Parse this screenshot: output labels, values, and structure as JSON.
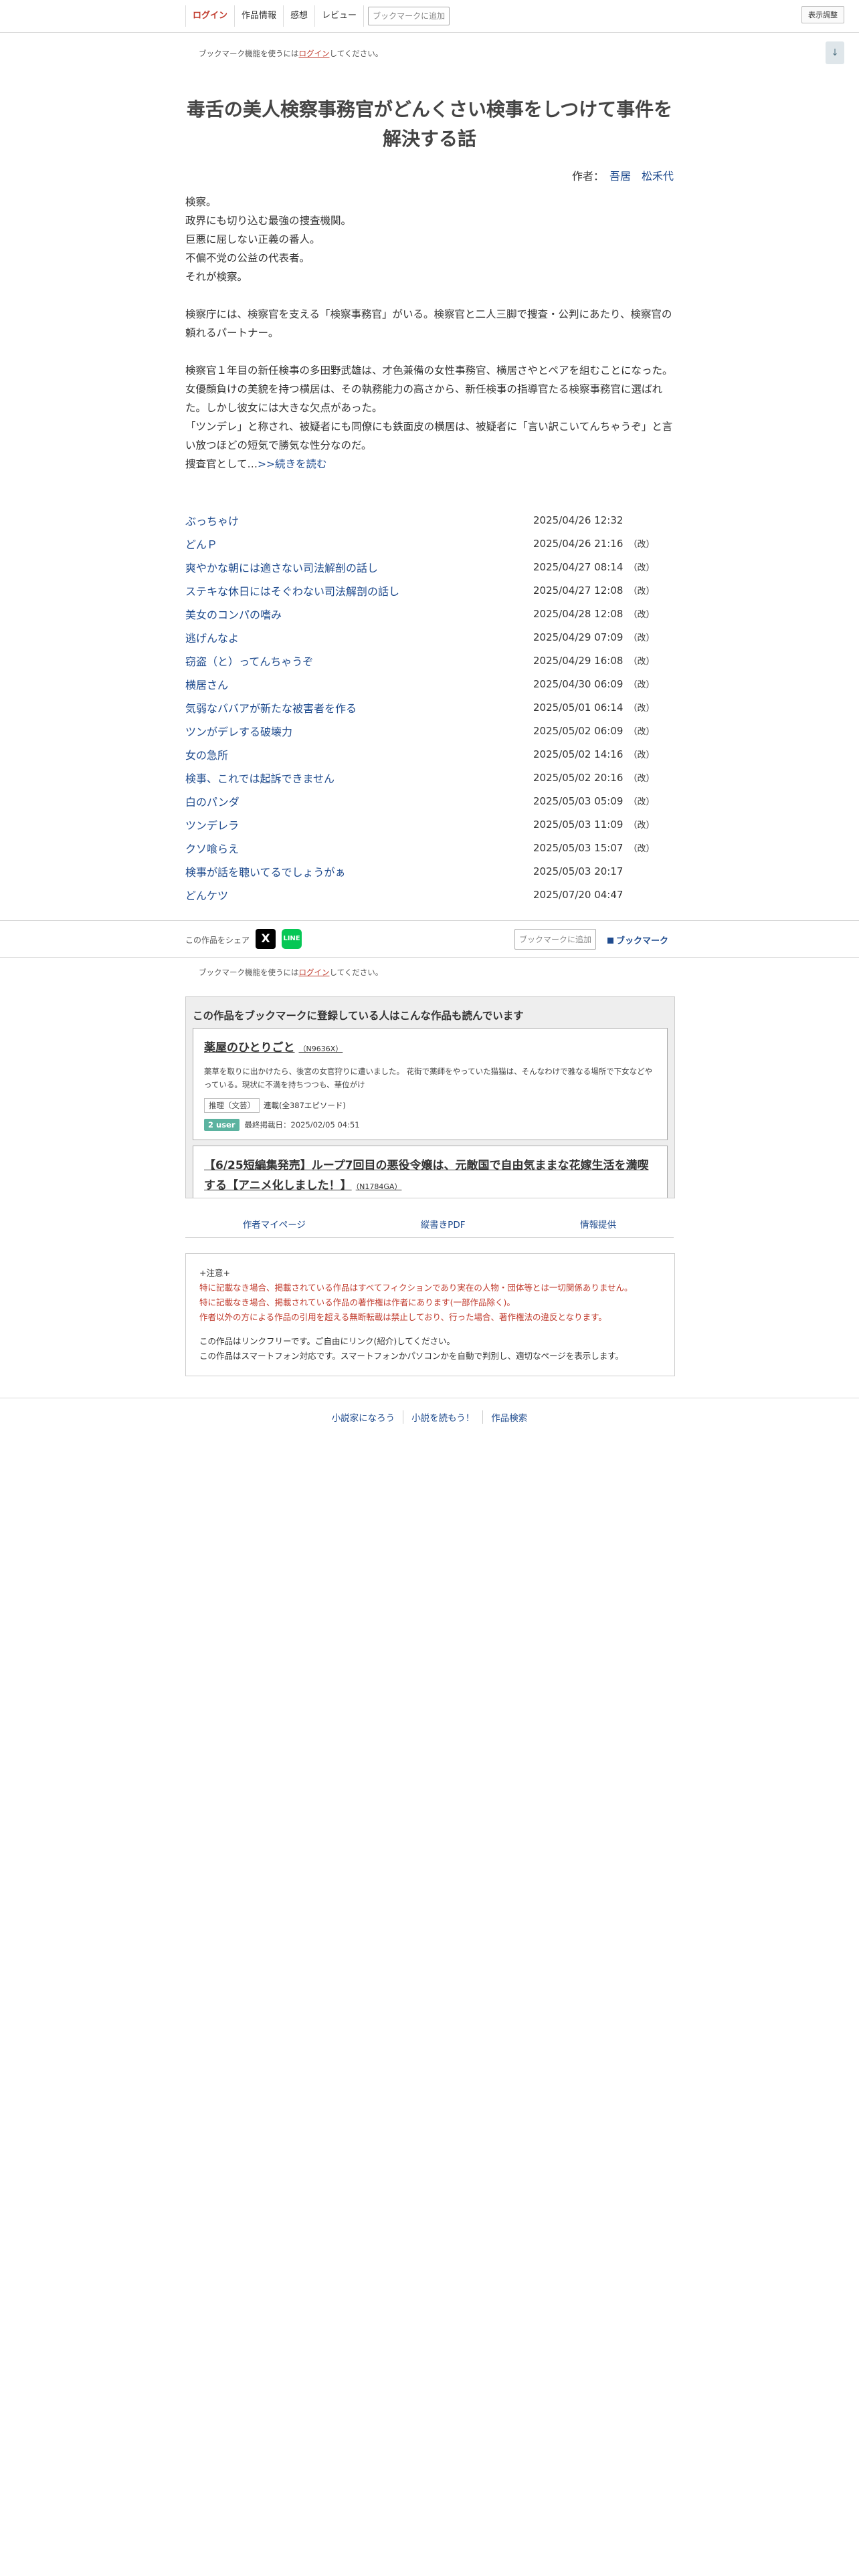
{
  "topbar": {
    "login": "ログイン",
    "info": "作品情報",
    "impression": "感想",
    "review": "レビュー",
    "bookmark_add": "ブックマークに追加",
    "display": "表示調整"
  },
  "notice": {
    "prefix": "ブックマーク機能を使うには",
    "link": "ログイン",
    "suffix": "してください。"
  },
  "scroll_top": "↓",
  "novel": {
    "title": "毒舌の美人検察事務官がどんくさい検事をしつけて事件を解決する話",
    "author_label": "作者：",
    "author": "吾居　松禾代"
  },
  "synopsis": [
    "検察。",
    "政界にも切り込む最強の捜査機関。",
    "巨悪に屈しない正義の番人。",
    "不偏不党の公益の代表者。",
    "それが検察。",
    "",
    "検察庁には、検察官を支える「検察事務官」がいる。検察官と二人三脚で捜査・公判にあたり、検察官の頼れるパートナー。",
    "",
    "検察官１年目の新任検事の多田野武雄は、才色兼備の女性事務官、横居さやとペアを組むことになった。女優顔負けの美貌を持つ横居は、その執務能力の高さから、新任検事の指導官たる検察事務官に選ばれた。しかし彼女には大きな欠点があった。",
    "「ツンデレ」と称され、被疑者にも同僚にも鉄面皮の横居は、被疑者に「言い訳こいてんちゃうぞ」と言い放つほどの短気で勝気な性分なのだ。"
  ],
  "synopsis_last": "捜査官として…",
  "synopsis_more": ">>続きを読む",
  "episodes": [
    {
      "title": "ぶっちゃけ",
      "date": "2025/04/26 12:32",
      "rev": ""
    },
    {
      "title": "どんＰ",
      "date": "2025/04/26 21:16",
      "rev": "（改）"
    },
    {
      "title": "爽やかな朝には適さない司法解剖の話し",
      "date": "2025/04/27 08:14",
      "rev": "（改）"
    },
    {
      "title": "ステキな休日にはそぐわない司法解剖の話し",
      "date": "2025/04/27 12:08",
      "rev": "（改）"
    },
    {
      "title": "美女のコンパの嗜み",
      "date": "2025/04/28 12:08",
      "rev": "（改）"
    },
    {
      "title": "逃げんなよ",
      "date": "2025/04/29 07:09",
      "rev": "（改）"
    },
    {
      "title": "窃盗（と）ってんちゃうぞ",
      "date": "2025/04/29 16:08",
      "rev": "（改）"
    },
    {
      "title": "横居さん",
      "date": "2025/04/30 06:09",
      "rev": "（改）"
    },
    {
      "title": "気弱なババアが新たな被害者を作る",
      "date": "2025/05/01 06:14",
      "rev": "（改）"
    },
    {
      "title": "ツンがデレする破壊力",
      "date": "2025/05/02 06:09",
      "rev": "（改）"
    },
    {
      "title": "女の急所",
      "date": "2025/05/02 14:16",
      "rev": "（改）"
    },
    {
      "title": "検事、これでは起訴できません",
      "date": "2025/05/02 20:16",
      "rev": "（改）"
    },
    {
      "title": "白のパンダ",
      "date": "2025/05/03 05:09",
      "rev": "（改）"
    },
    {
      "title": "ツンデレラ",
      "date": "2025/05/03 11:09",
      "rev": "（改）"
    },
    {
      "title": "クソ喰らえ",
      "date": "2025/05/03 15:07",
      "rev": "（改）"
    },
    {
      "title": "検事が話を聴いてるでしょうがぁ",
      "date": "2025/05/03 20:17",
      "rev": ""
    },
    {
      "title": "どんケツ",
      "date": "2025/07/20 04:47",
      "rev": ""
    }
  ],
  "share": {
    "label": "この作品をシェア",
    "x": "X",
    "line": "LINE",
    "bookmark_add": "ブックマークに追加",
    "bookmark": "ブックマーク"
  },
  "recommend": {
    "heading": "この作品をブックマークに登録している人はこんな作品も読んでいます",
    "cards": [
      {
        "title": "薬屋のひとりごと",
        "ncode": "（N9636X）",
        "desc": "薬草を取りに出かけたら、後宮の女官狩りに遭いました。 花街で薬師をやっていた猫猫は、そんなわけで雅なる場所で下女などやっている。現状に不満を持ちつつも、華位がけ",
        "genre": "推理〔文芸〕",
        "status": "連載(全387エピソード)",
        "users": "2 user",
        "updated": "最終掲載日：2025/02/05 04:51"
      },
      {
        "title": "【6/25短編集発売】ループ7回目の悪役令嬢は、元敵国で自由気ままな花嫁生活を満喫する【アニメ化しました！】",
        "ncode": "（N1784GA）"
      }
    ]
  },
  "links": {
    "author_page": "作者マイページ",
    "pdf": "縦書きPDF",
    "report": "情報提供"
  },
  "caution": {
    "head": "+注意+",
    "red1": "特に記載なき場合、掲載されている作品はすべてフィクションであり実在の人物・団体等とは一切関係ありません。",
    "red2": "特に記載なき場合、掲載されている作品の著作権は作者にあります(一部作品除く)。",
    "red3": "作者以外の方による作品の引用を超える無断転載は禁止しており、行った場合、著作権法の違反となります。",
    "n1": "この作品はリンクフリーです。ご自由にリンク(紹介)してください。",
    "n2": "この作品はスマートフォン対応です。スマートフォンかパソコンかを自動で判別し、適切なページを表示します。"
  },
  "footer": {
    "a": "小説家になろう",
    "b": "小説を読もう！",
    "c": "作品検索"
  }
}
